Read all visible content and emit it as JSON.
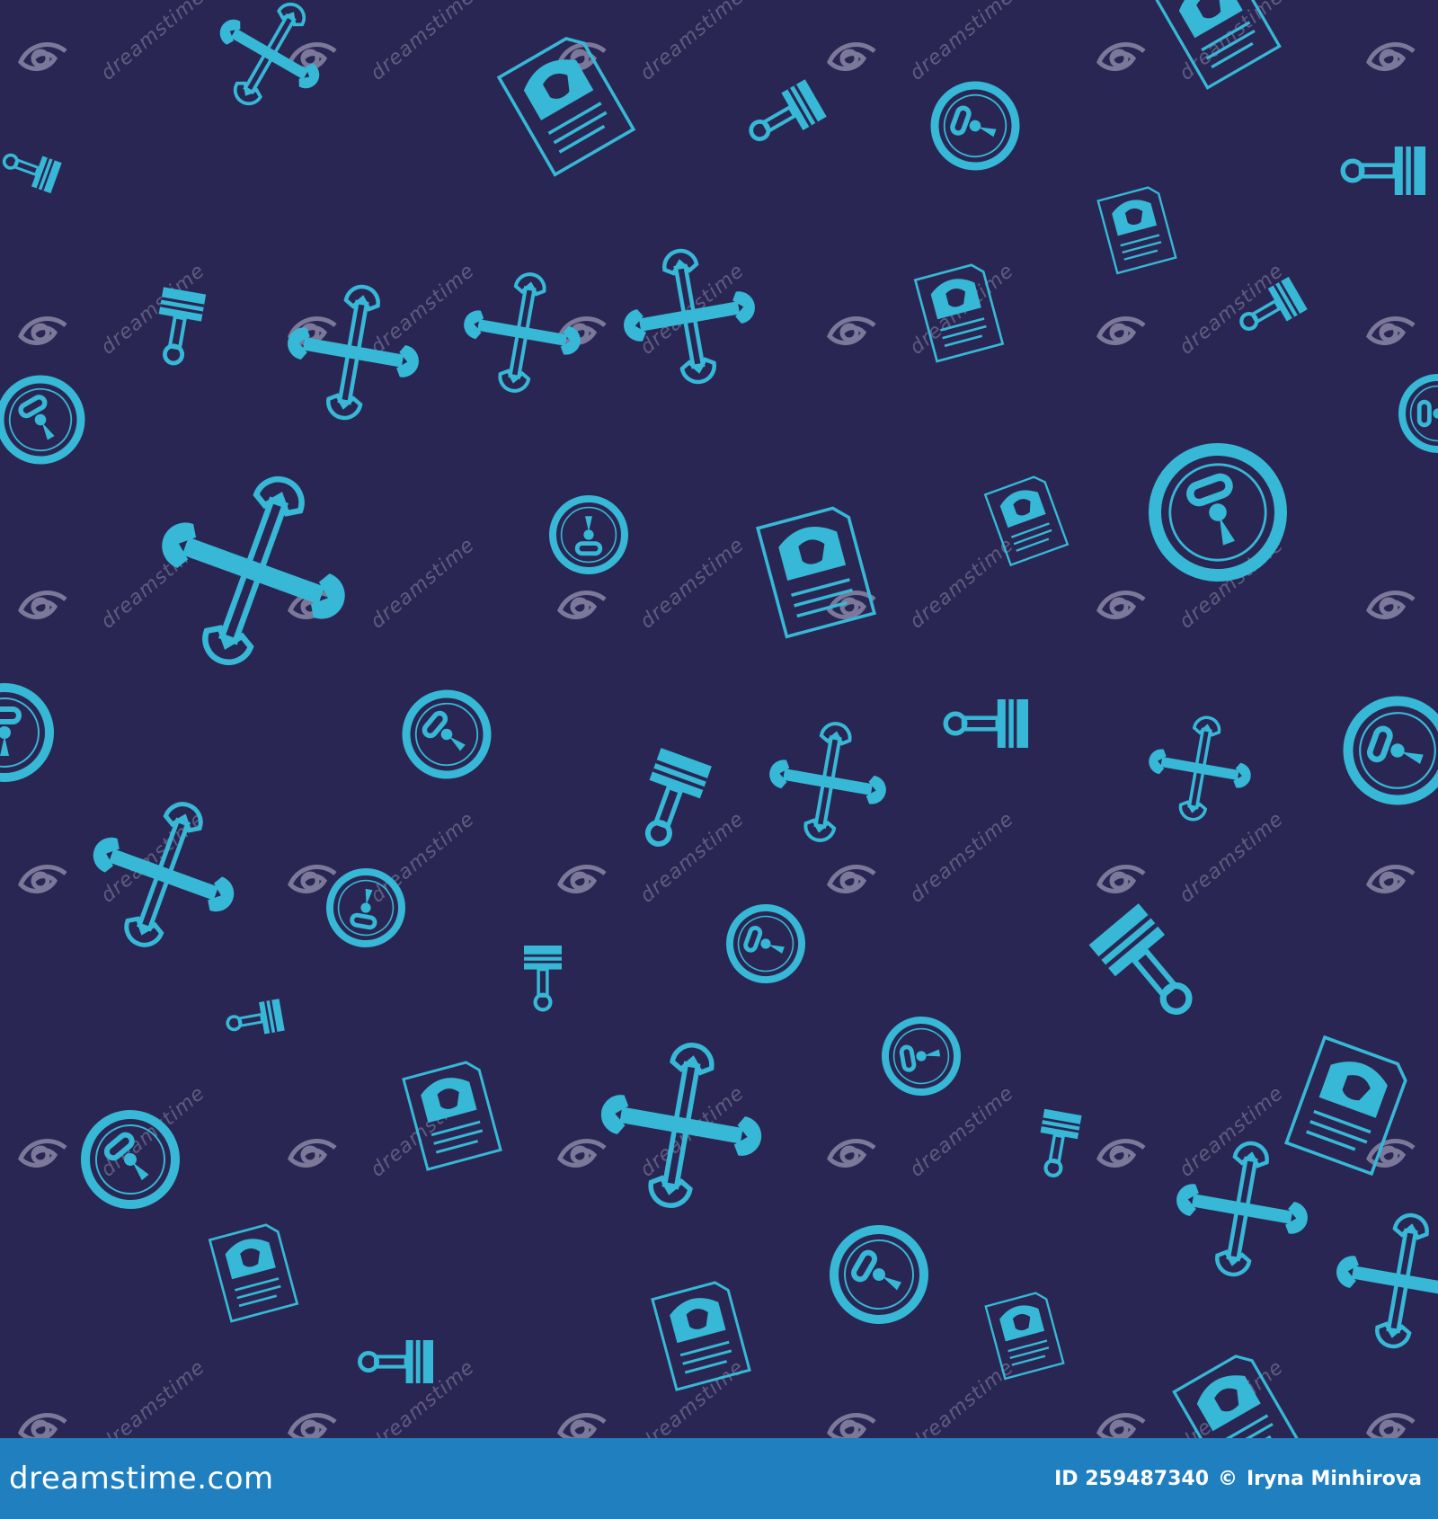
{
  "colors": {
    "background": "#2a2653",
    "icon": "#36b8d6",
    "watermark": "#8a87a6",
    "footer_background": "#1f7fbf",
    "footer_text": "#ffffff"
  },
  "pattern": {
    "icon_types": [
      "crossed-wrenches",
      "speedometer",
      "piston",
      "document-with-helmet"
    ],
    "watermark_text": "dreamstime"
  },
  "footer": {
    "logo_text": "dreamstime.com",
    "image_id": "ID 259487340",
    "copyright_symbol": "©",
    "author": "Iryna Minhirova"
  }
}
